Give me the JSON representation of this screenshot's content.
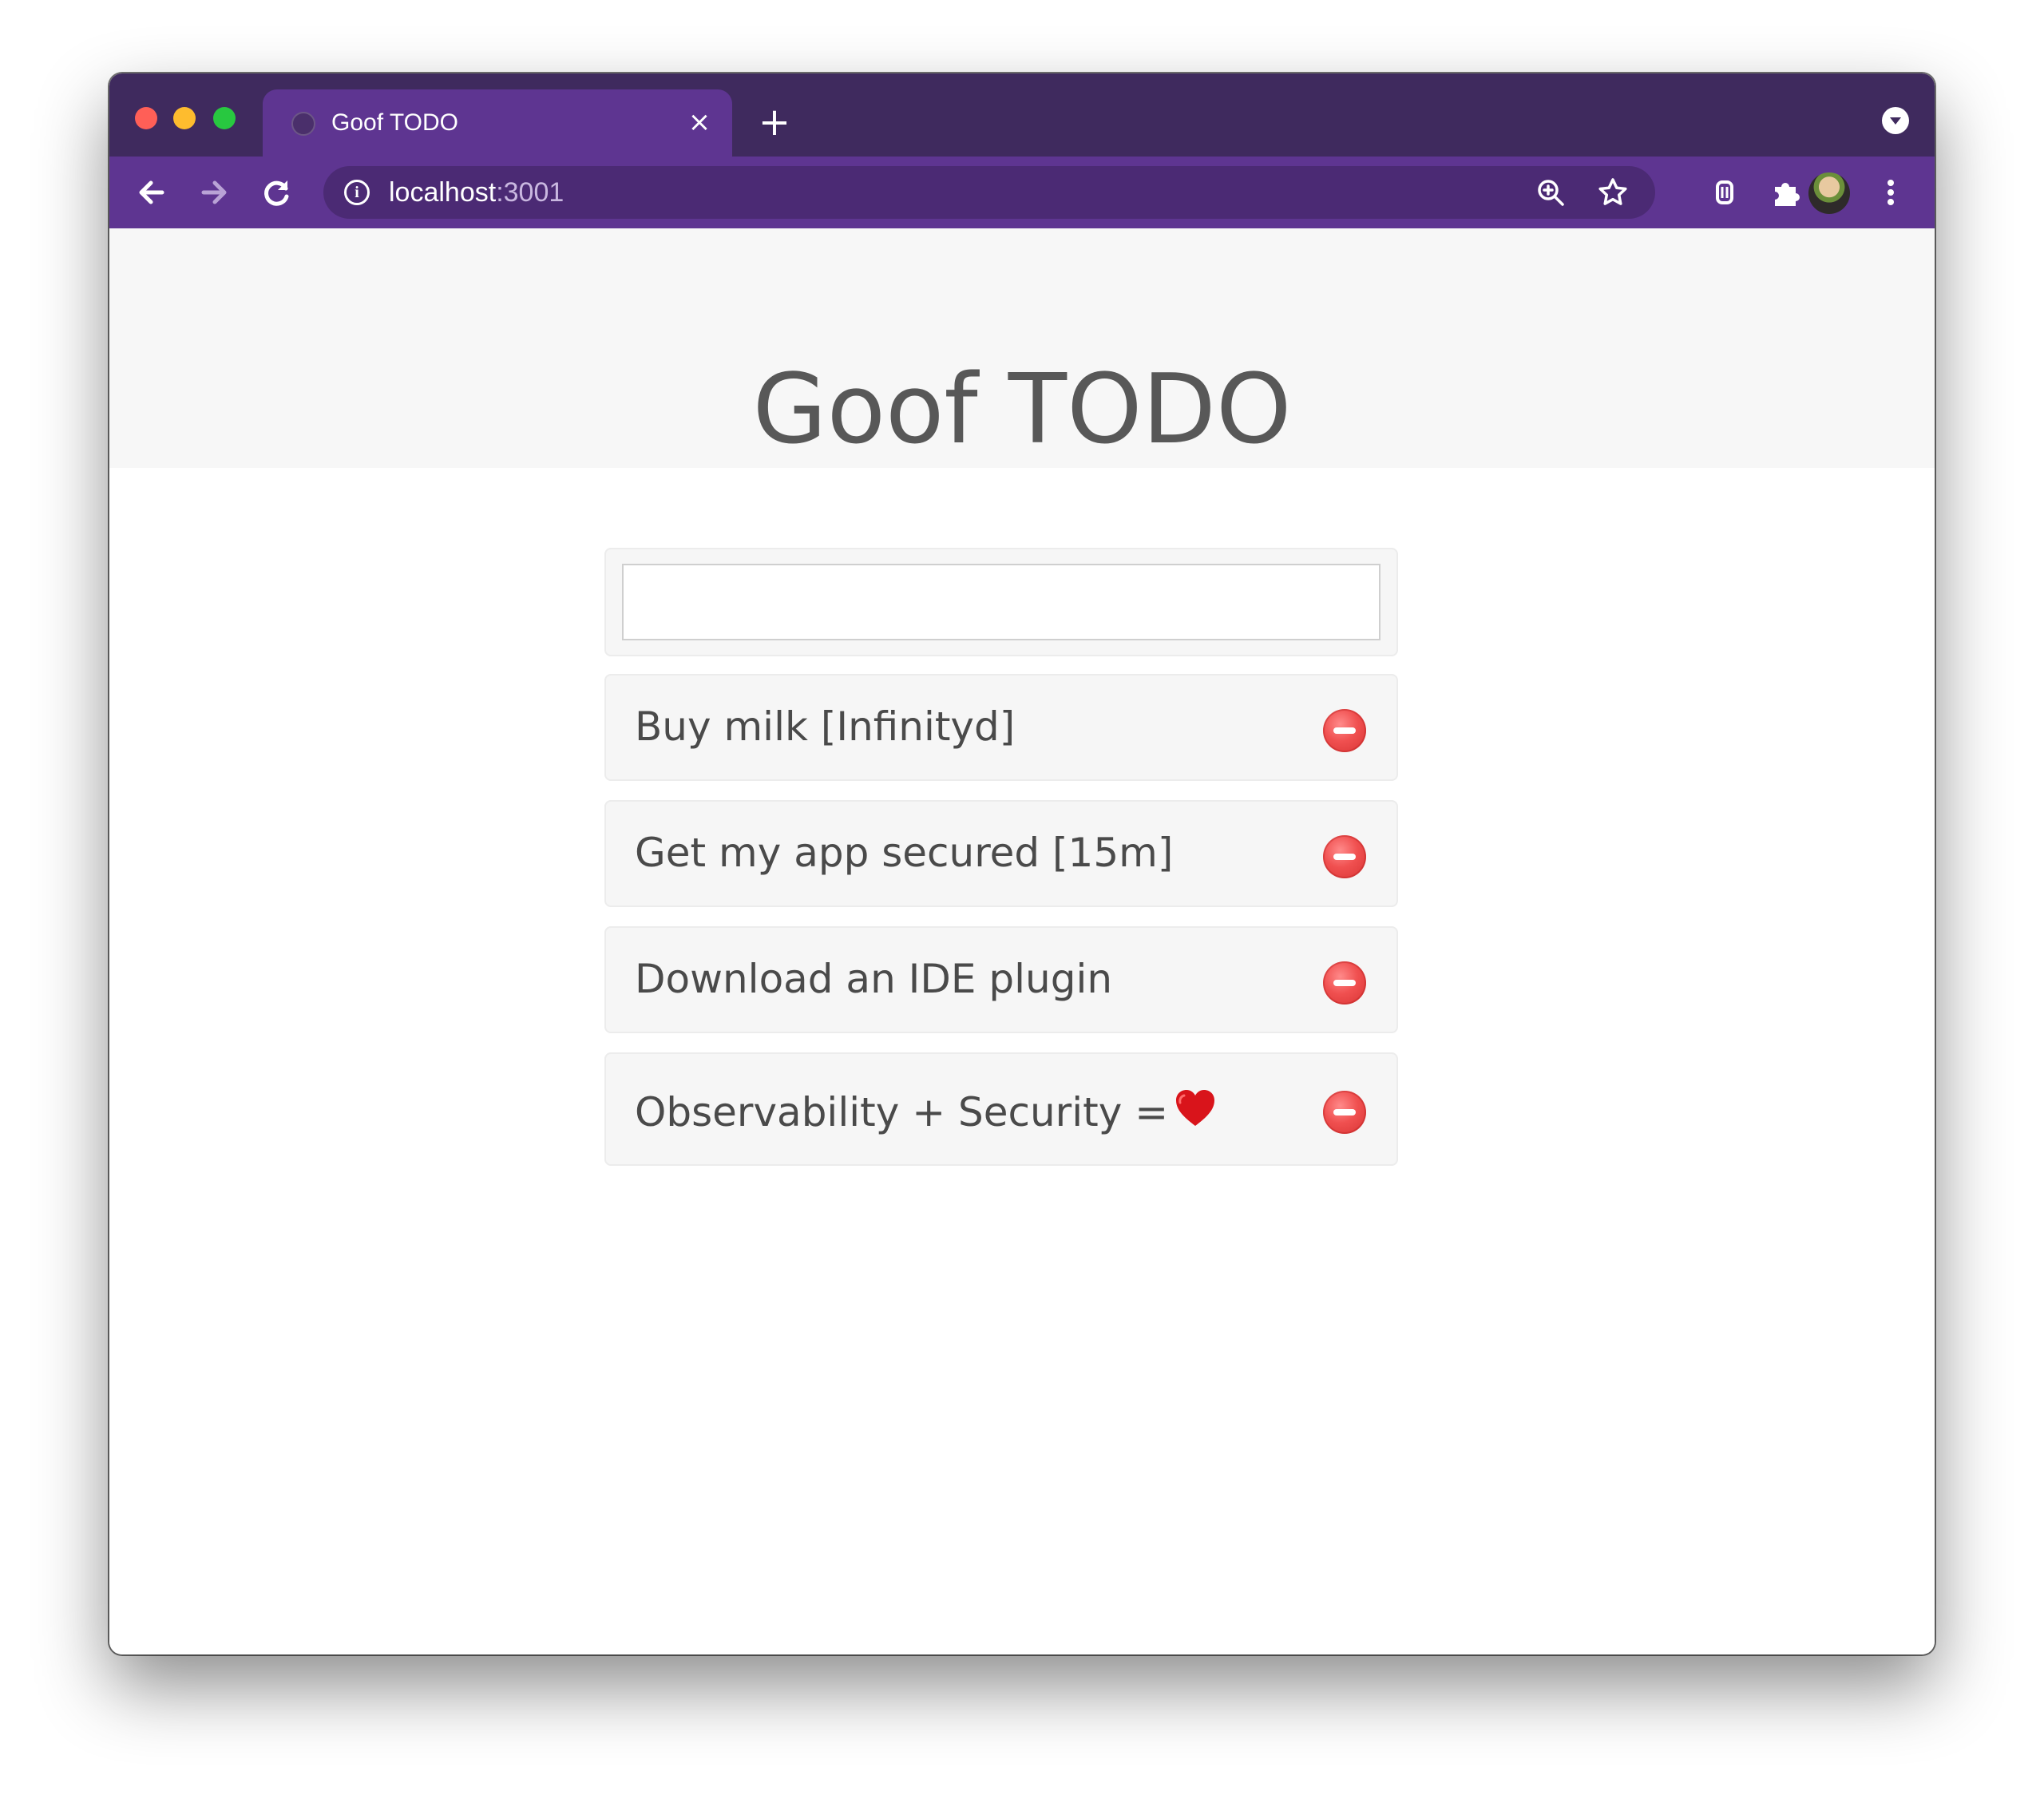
{
  "browser": {
    "tab_title": "Goof TODO",
    "tab_close_glyph": "×",
    "new_tab_glyph": "+",
    "url_host": "localhost",
    "url_port": ":3001",
    "icons": [
      "back-icon",
      "forward-icon",
      "reload-icon",
      "info-icon",
      "zoom-icon",
      "star-icon",
      "extension-icon",
      "puzzle-icon",
      "avatar",
      "menu-icon"
    ]
  },
  "page": {
    "title": "Goof TODO",
    "input_value": ""
  },
  "todos": [
    {
      "text": "Buy milk [Infinityd]",
      "heart": false
    },
    {
      "text": "Get my app secured [15m]",
      "heart": false
    },
    {
      "text": "Download an IDE plugin",
      "heart": false
    },
    {
      "text": "Observability + Security =",
      "heart": true
    }
  ],
  "colors": {
    "tabstrip": "#3f2a5e",
    "toolbar": "#5e3591",
    "remove_button": "#f05050",
    "heart": "#d9141b"
  }
}
